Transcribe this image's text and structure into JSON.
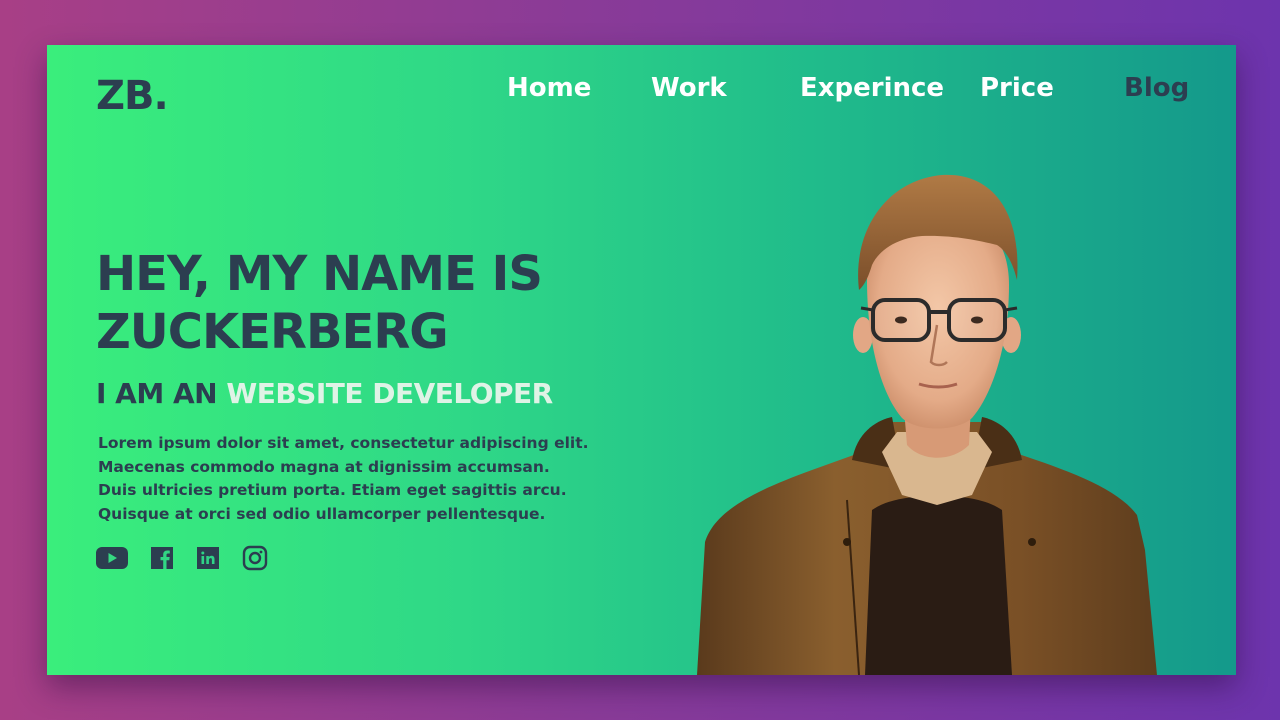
{
  "logo": "ZB.",
  "nav": {
    "items": [
      {
        "label": "Home"
      },
      {
        "label": "Work"
      },
      {
        "label": "Experince"
      },
      {
        "label": "Price"
      },
      {
        "label": "Blog"
      }
    ]
  },
  "hero": {
    "headline": "HEY, MY NAME IS ZUCKERBERG",
    "sub_prefix": "I AM AN ",
    "sub_highlight": "WEBSITE DEVELOPER",
    "bio_lines": [
      "Lorem ipsum dolor sit amet, consectetur adipiscing elit.",
      "Maecenas commodo magna at dignissim accumsan.",
      "Duis ultricies pretium porta. Etiam eget sagittis arcu.",
      "Quisque at orci sed odio ullamcorper pellentesque."
    ]
  },
  "socials": [
    {
      "icon": "youtube-icon"
    },
    {
      "icon": "facebook-icon"
    },
    {
      "icon": "linkedin-icon"
    },
    {
      "icon": "instagram-icon"
    }
  ],
  "colors": {
    "text_dark": "#2c3e50",
    "highlight": "#dff3e6",
    "card_gradient_start": "#3aee7c",
    "card_gradient_end": "#14998b",
    "bg_gradient_start": "#a83f86",
    "bg_gradient_end": "#6d34ad"
  }
}
